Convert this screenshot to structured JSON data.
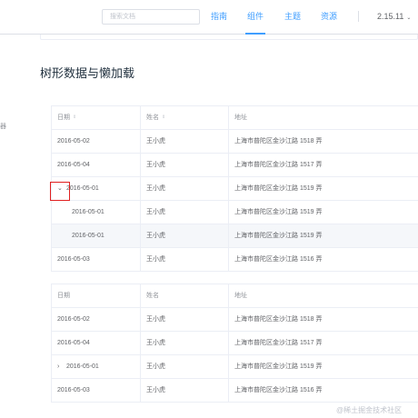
{
  "header": {
    "search_placeholder": "搜索文档",
    "nav": [
      "指南",
      "组件",
      "主题",
      "资源"
    ],
    "version": "2.15.11",
    "version_caret": "⌄"
  },
  "sidebar": {
    "fragment": "器"
  },
  "section": {
    "title": "树形数据与懒加载"
  },
  "table1": {
    "headers": [
      "日期",
      "姓名",
      "地址"
    ],
    "sort_icon": "⇕",
    "expanded_icon": "⌄",
    "rows": [
      {
        "date": "2016-05-02",
        "name": "王小虎",
        "address": "上海市普陀区金沙江路 1518 弄"
      },
      {
        "date": "2016-05-04",
        "name": "王小虎",
        "address": "上海市普陀区金沙江路 1517 弄"
      },
      {
        "date": "2016-05-01",
        "name": "王小虎",
        "address": "上海市普陀区金沙江路 1519 弄"
      },
      {
        "date": "2016-05-01",
        "name": "王小虎",
        "address": "上海市普陀区金沙江路 1519 弄"
      },
      {
        "date": "2016-05-01",
        "name": "王小虎",
        "address": "上海市普陀区金沙江路 1519 弄"
      },
      {
        "date": "2016-05-03",
        "name": "王小虎",
        "address": "上海市普陀区金沙江路 1516 弄"
      }
    ]
  },
  "table2": {
    "headers": [
      "日期",
      "姓名",
      "地址"
    ],
    "collapsed_icon": "›",
    "rows": [
      {
        "date": "2016-05-02",
        "name": "王小虎",
        "address": "上海市普陀区金沙江路 1518 弄"
      },
      {
        "date": "2016-05-04",
        "name": "王小虎",
        "address": "上海市普陀区金沙江路 1517 弄"
      },
      {
        "date": "2016-05-01",
        "name": "王小虎",
        "address": "上海市普陀区金沙江路 1519 弄"
      },
      {
        "date": "2016-05-03",
        "name": "王小虎",
        "address": "上海市普陀区金沙江路 1516 弄"
      }
    ]
  },
  "watermark": "@稀土掘金技术社区"
}
